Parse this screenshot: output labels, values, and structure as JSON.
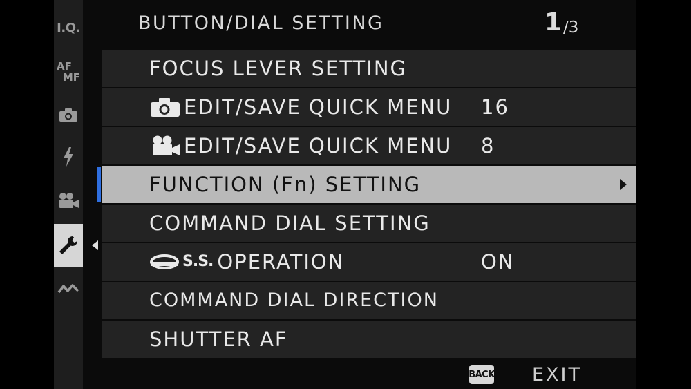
{
  "header": {
    "title": "BUTTON/DIAL SETTING",
    "page_current": "1",
    "page_total": "/3"
  },
  "sidebar": {
    "items": [
      {
        "label": "I.Q.",
        "icon": "iq-icon"
      },
      {
        "label_top": "AF",
        "label_bottom": "MF",
        "icon": "af-mf-icon"
      },
      {
        "icon": "camera-icon"
      },
      {
        "icon": "flash-icon"
      },
      {
        "icon": "movie-camera-icon"
      },
      {
        "icon": "wrench-icon",
        "active": true
      },
      {
        "icon": "connection-icon"
      }
    ]
  },
  "menu": {
    "items": [
      {
        "label": "FOCUS LEVER SETTING",
        "value": ""
      },
      {
        "label": "EDIT/SAVE QUICK MENU",
        "icon": "camera-icon",
        "value": "16"
      },
      {
        "label": "EDIT/SAVE QUICK MENU",
        "icon": "movie-camera-icon",
        "value": "8"
      },
      {
        "label": "FUNCTION (Fn) SETTING",
        "value": "",
        "selected": true
      },
      {
        "label": "COMMAND DIAL SETTING",
        "value": ""
      },
      {
        "label": "OPERATION",
        "prefix": "S.S.",
        "icon": "dial-ring-icon",
        "value": "ON"
      },
      {
        "label": "COMMAND DIAL DIRECTION",
        "value": ""
      },
      {
        "label": "SHUTTER AF",
        "value": ""
      }
    ]
  },
  "footer": {
    "back_label": "BACK",
    "exit_label": "EXIT"
  },
  "colors": {
    "accent": "#2f6fe0",
    "selected_row": "#b9b9b9",
    "row_bg": "#232323",
    "sidebar_active": "#d6d6d6"
  }
}
